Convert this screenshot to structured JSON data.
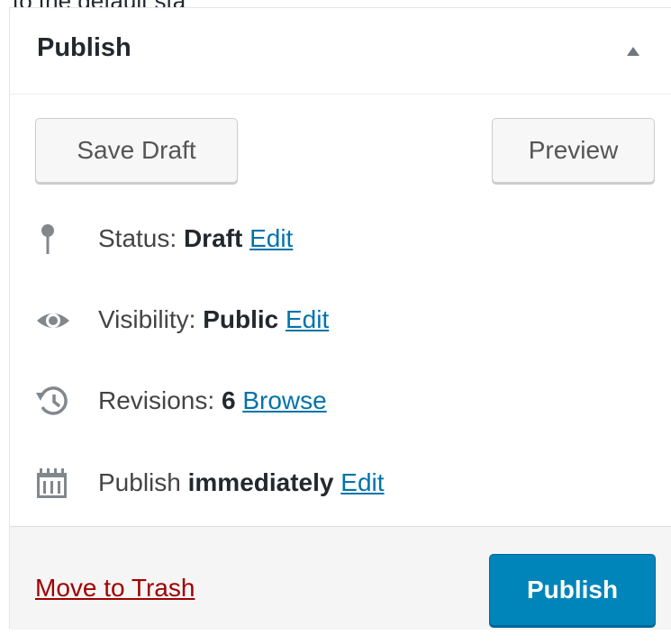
{
  "top_strip_text": "to the default sta",
  "publish_box": {
    "title": "Publish",
    "toggle_icon": "triangle-up-icon",
    "save_draft_label": "Save Draft",
    "preview_label": "Preview",
    "status": {
      "icon": "pin-icon",
      "label": "Status:",
      "value": "Draft",
      "link": "Edit"
    },
    "visibility": {
      "icon": "eye-icon",
      "label": "Visibility:",
      "value": "Public",
      "link": "Edit"
    },
    "revisions": {
      "icon": "history-icon",
      "label": "Revisions:",
      "value": "6",
      "link": "Browse"
    },
    "schedule": {
      "icon": "calendar-icon",
      "label": "Publish",
      "value": "immediately",
      "link": "Edit"
    },
    "trash_label": "Move to Trash",
    "publish_label": "Publish"
  },
  "colors": {
    "link": "#0073aa",
    "trash": "#a00000",
    "primary_button": "#0085ba",
    "footer_bg": "#f5f5f5",
    "icon": "#82878c"
  }
}
